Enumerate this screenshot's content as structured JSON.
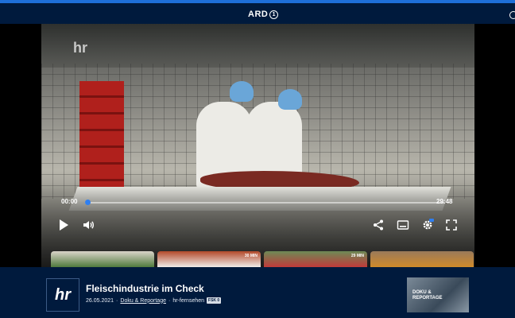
{
  "header": {
    "logo_text": "ARD",
    "logo_badge": "1"
  },
  "player": {
    "watermark": "hr",
    "current_time": "00:00",
    "duration": "29:48",
    "progress": 0.0,
    "controls": {
      "play_icon": "play-icon",
      "volume_icon": "volume-icon",
      "share_icon": "share-icon",
      "subtitles_icon": "subtitles-icon",
      "settings_icon": "gear-icon",
      "fullscreen_icon": "fullscreen-icon"
    },
    "thumbnails": [
      {
        "duration": ""
      },
      {
        "duration": "30 MIN"
      },
      {
        "duration": "29 MIN"
      },
      {
        "duration": ""
      }
    ]
  },
  "info": {
    "channel_logo": "hr",
    "title": "Fleischindustrie im Check",
    "date": "26.05.2021",
    "separator": "·",
    "category": "Doku & Reportage",
    "channel": "hr-fernsehen",
    "rating": "FSK 0",
    "recommendation_label_line1": "DOKU &",
    "recommendation_label_line2": "REPORTAGE"
  },
  "colors": {
    "accent": "#1e6fd9",
    "background": "#001a3d",
    "progress_knob": "#2f7ff0"
  }
}
